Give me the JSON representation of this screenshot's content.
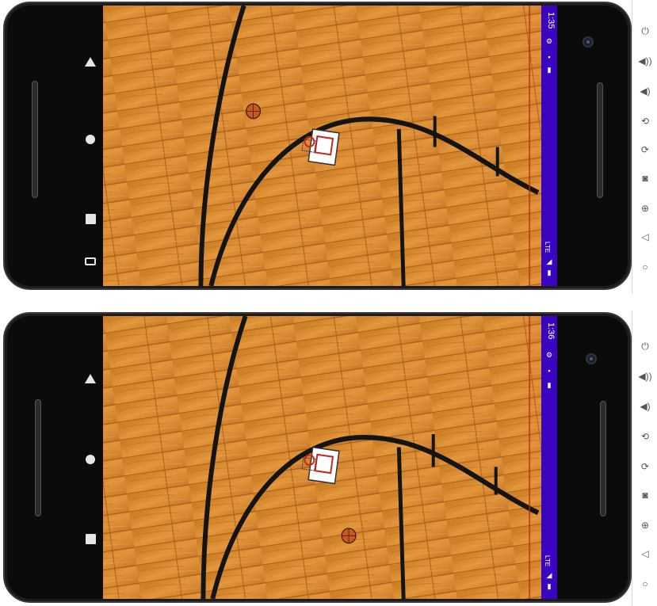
{
  "screens": [
    {
      "status": {
        "time": "1:35",
        "network": "LTE"
      }
    },
    {
      "status": {
        "time": "1:36",
        "network": "LTE"
      }
    }
  ],
  "nav_icons": [
    "back-triangle-icon",
    "home-circle-icon",
    "recents-square-icon",
    "rotate-icon"
  ],
  "status_icons": [
    "gear-icon",
    "sim-icon",
    "sd-card-icon",
    "signal-icon",
    "battery-icon"
  ],
  "emulator_tools": [
    {
      "name": "power-icon",
      "glyph": "⏻"
    },
    {
      "name": "volume-up-icon",
      "glyph": "🔊"
    },
    {
      "name": "volume-down-icon",
      "glyph": "🔉"
    },
    {
      "name": "rotate-left-icon",
      "glyph": "⟲"
    },
    {
      "name": "rotate-right-icon",
      "glyph": "⟳"
    },
    {
      "name": "camera-icon",
      "glyph": "📷"
    },
    {
      "name": "zoom-icon",
      "glyph": "🔍"
    },
    {
      "name": "back-icon",
      "glyph": "◁"
    },
    {
      "name": "home-icon",
      "glyph": "○"
    }
  ],
  "colors": {
    "statusbar": "#3a05c2",
    "wood": "#d98a2a",
    "lines": "#141414",
    "ball": "#c8581c"
  }
}
